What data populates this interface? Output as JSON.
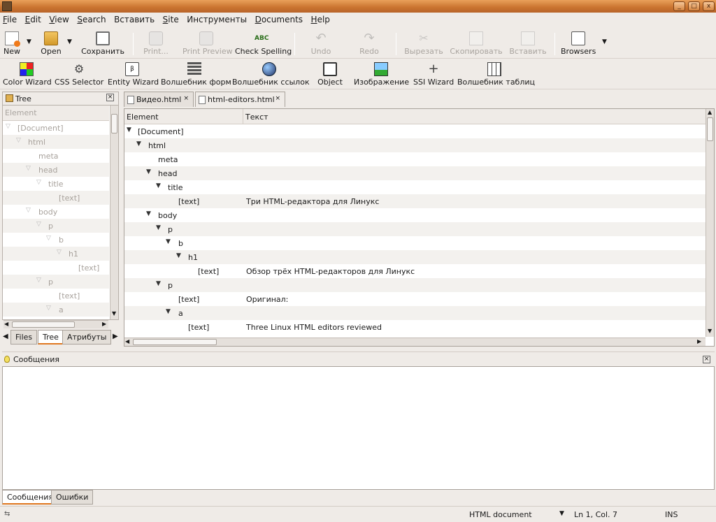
{
  "menu": {
    "items": [
      {
        "mn": "F",
        "rest": "ile"
      },
      {
        "mn": "E",
        "rest": "dit"
      },
      {
        "mn": "V",
        "rest": "iew"
      },
      {
        "mn": "S",
        "rest": "earch"
      },
      {
        "mn": "",
        "rest": "Вставить"
      },
      {
        "mn": "S",
        "rest": "ite"
      },
      {
        "mn": "",
        "rest": "Инструменты"
      },
      {
        "mn": "D",
        "rest": "ocuments"
      },
      {
        "mn": "H",
        "rest": "elp"
      }
    ]
  },
  "toolbar1": {
    "new": "New",
    "open": "Open",
    "save": "Сохранить",
    "print": "Print...",
    "print_preview": "Print Preview",
    "check_spelling": "Check Spelling",
    "undo": "Undo",
    "redo": "Redo",
    "cut": "Вырезать",
    "copy": "Скопировать",
    "paste": "Вставить",
    "browsers": "Browsers"
  },
  "toolbar2": {
    "color_wizard": "Color Wizard",
    "css_selector": "CSS Selector",
    "entity_wizard": "Entity Wizard",
    "form_wizard": "Волшебник форм",
    "link_wizard": "Волшебник ссылок",
    "object": "Object",
    "image": "Изображение",
    "ssi_wizard": "SSI Wizard",
    "table_wizard": "Волшебник таблиц",
    "entity_icon_text": "β"
  },
  "left_panel": {
    "title": "Tree",
    "column": "Element",
    "rows": [
      "[Document]",
      "html",
      "meta",
      "head",
      "title",
      "[text]",
      "body",
      "p",
      "b",
      "h1",
      "[text]",
      "p",
      "[text]",
      "a"
    ],
    "tabs": [
      "Files",
      "Tree",
      "Атрибуты"
    ]
  },
  "doc_tabs": [
    "Видео.html",
    "html-editors.html"
  ],
  "doc_tree": {
    "col_element": "Element",
    "col_text": "Текст",
    "rows": [
      {
        "el": "[Document]",
        "tx": ""
      },
      {
        "el": "html",
        "tx": ""
      },
      {
        "el": "meta",
        "tx": ""
      },
      {
        "el": "head",
        "tx": ""
      },
      {
        "el": "title",
        "tx": ""
      },
      {
        "el": "[text]",
        "tx": "Три HTML-редактора для Линукс"
      },
      {
        "el": "body",
        "tx": ""
      },
      {
        "el": "p",
        "tx": ""
      },
      {
        "el": "b",
        "tx": ""
      },
      {
        "el": "h1",
        "tx": ""
      },
      {
        "el": "[text]",
        "tx": "Обзор трёх HTML-редакторов для Линукс"
      },
      {
        "el": "p",
        "tx": ""
      },
      {
        "el": "[text]",
        "tx": "Оригинал:"
      },
      {
        "el": "a",
        "tx": ""
      },
      {
        "el": "[text]",
        "tx": "Three Linux HTML editors reviewed"
      }
    ]
  },
  "messages": {
    "title": "Сообщения",
    "tabs": [
      "Сообщения",
      "Ошибки"
    ]
  },
  "status": {
    "doc_type": "HTML document",
    "position": "Ln 1, Col. 7",
    "mode": "INS"
  },
  "glyphs": {
    "close": "×",
    "tri_down": "▽",
    "tri_down_solid": "▼",
    "drop": "▼",
    "arrow_up": "▲",
    "arrow_down": "▼",
    "arrow_left": "◀",
    "arrow_right": "▶",
    "min": "_",
    "max": "□",
    "x": "x"
  }
}
